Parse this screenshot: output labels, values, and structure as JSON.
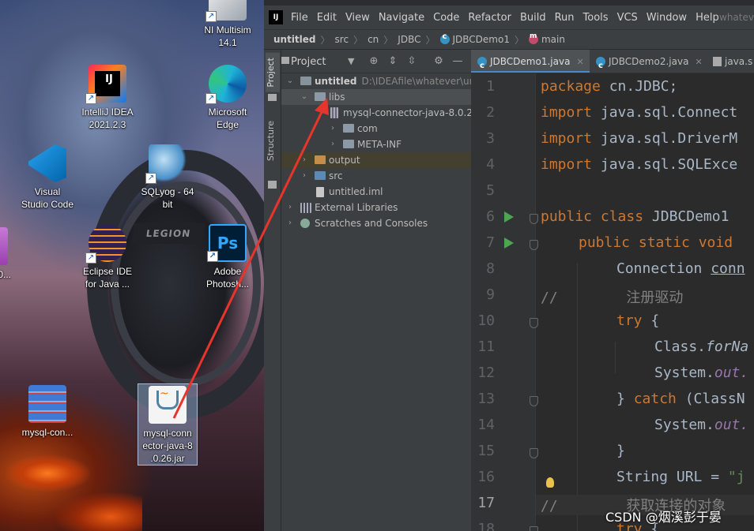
{
  "desktop": {
    "wallpaper_text": "LEGION",
    "icons": [
      {
        "label": "NI Multisim\n14.1"
      },
      {
        "label": "IntelliJ IDEA\n2021.2.3"
      },
      {
        "label": "Microsoft\nEdge"
      },
      {
        "label": "Visual\nStudio Code"
      },
      {
        "label": "SQLyog - 64\nbit"
      },
      {
        "label": "Eclipse IDE\nfor Java ..."
      },
      {
        "label": "Adobe\nPhotosh..."
      },
      {
        "label": "mysql-con..."
      },
      {
        "label": "mysql-conn\nector-java-8\n.0.26.jar"
      },
      {
        "label": "0..."
      }
    ]
  },
  "ide": {
    "logo": "IJ",
    "menu": [
      "File",
      "Edit",
      "View",
      "Navigate",
      "Code",
      "Refactor",
      "Build",
      "Run",
      "Tools",
      "VCS",
      "Window",
      "Help"
    ],
    "project_name_title": "whatev",
    "breadcrumb": [
      "untitled",
      "src",
      "cn",
      "JDBC",
      "JDBCDemo1",
      "main"
    ],
    "side_tabs": [
      "Project",
      "Structure"
    ],
    "project_panel": {
      "title": "Project",
      "tree": [
        {
          "label": "untitled",
          "path": "D:\\IDEAfile\\whatever\\unt"
        },
        {
          "label": "libs"
        },
        {
          "label": "mysql-connector-java-8.0.26"
        },
        {
          "label": "com"
        },
        {
          "label": "META-INF"
        },
        {
          "label": "output"
        },
        {
          "label": "src"
        },
        {
          "label": "untitled.iml"
        },
        {
          "label": "External Libraries"
        },
        {
          "label": "Scratches and Consoles"
        }
      ]
    },
    "tabs": [
      {
        "label": "JDBCDemo1.java"
      },
      {
        "label": "JDBCDemo2.java"
      },
      {
        "label": "java.s"
      }
    ],
    "line_numbers": [
      "1",
      "2",
      "3",
      "4",
      "5",
      "6",
      "7",
      "8",
      "9",
      "10",
      "11",
      "12",
      "13",
      "14",
      "15",
      "16",
      "17",
      "18"
    ],
    "code": {
      "l1_kw": "package ",
      "l1_rest": "cn.JDBC;",
      "l2_kw": "import ",
      "l2_rest": "java.sql.Connect",
      "l3_kw": "import ",
      "l3_rest": "java.sql.DriverM",
      "l4_kw": "import ",
      "l4_rest": "java.sql.SQLExce",
      "l6_kw": "public class ",
      "l6_rest": "JDBCDemo1",
      "l7_kw": "public static void",
      "l8_a": "Connection ",
      "l8_b": "conn",
      "l9": "//        注册驱动",
      "l10_kw": "try",
      "l10_rest": " {",
      "l11_a": "Class.",
      "l11_b": "forNa",
      "l12_a": "System.",
      "l12_b": "out.",
      "l13_a": "} ",
      "l13_kw": "catch",
      "l13_rest": " (ClassN",
      "l14_a": "System.",
      "l14_b": "out.",
      "l15": "}",
      "l16_a": "String URL = ",
      "l16_b": "\"j",
      "l17": "//        获取连接的对象",
      "l18_kw": "try",
      "l18_rest": " {"
    }
  },
  "watermark": "CSDN @烟溪彭于晏",
  "colors": {
    "ide_bg": "#2b2b2b",
    "panel_bg": "#3c3f41",
    "keyword": "#cc7832",
    "comment": "#808080",
    "annotation_arrow": "#e8352b"
  }
}
